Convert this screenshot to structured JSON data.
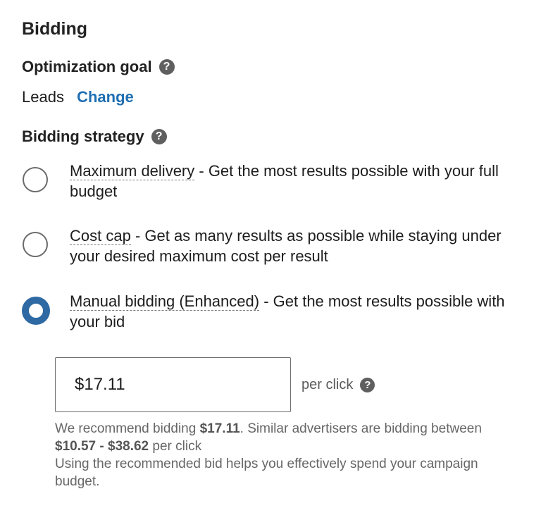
{
  "section": {
    "title": "Bidding"
  },
  "optimization": {
    "label": "Optimization goal",
    "help_icon": "question-circle-icon",
    "value": "Leads",
    "change_label": "Change"
  },
  "strategy": {
    "label": "Bidding strategy",
    "help_icon": "question-circle-icon",
    "options": [
      {
        "name": "Maximum delivery",
        "description": " - Get the most results possible with your full budget",
        "selected": false
      },
      {
        "name": "Cost cap",
        "description": " - Get as many results as possible while staying under your desired maximum cost per result",
        "selected": false
      },
      {
        "name": "Manual bidding (Enhanced)",
        "description": " - Get the most results possible with your bid",
        "selected": true
      }
    ]
  },
  "bid": {
    "value": "$17.11",
    "unit_label": "per click",
    "help_icon": "question-circle-icon"
  },
  "recommendation": {
    "prefix": "We recommend bidding ",
    "recommended": "$17.11",
    "middle": ". Similar advertisers are bidding between ",
    "range": "$10.57 - $38.62",
    "suffix": " per click",
    "line2": "Using the recommended bid helps you effectively spend your campaign budget."
  },
  "colors": {
    "accent": "#1f6fb2",
    "radio_selected": "#2e69a3",
    "help_icon": "#5f5f5f"
  }
}
